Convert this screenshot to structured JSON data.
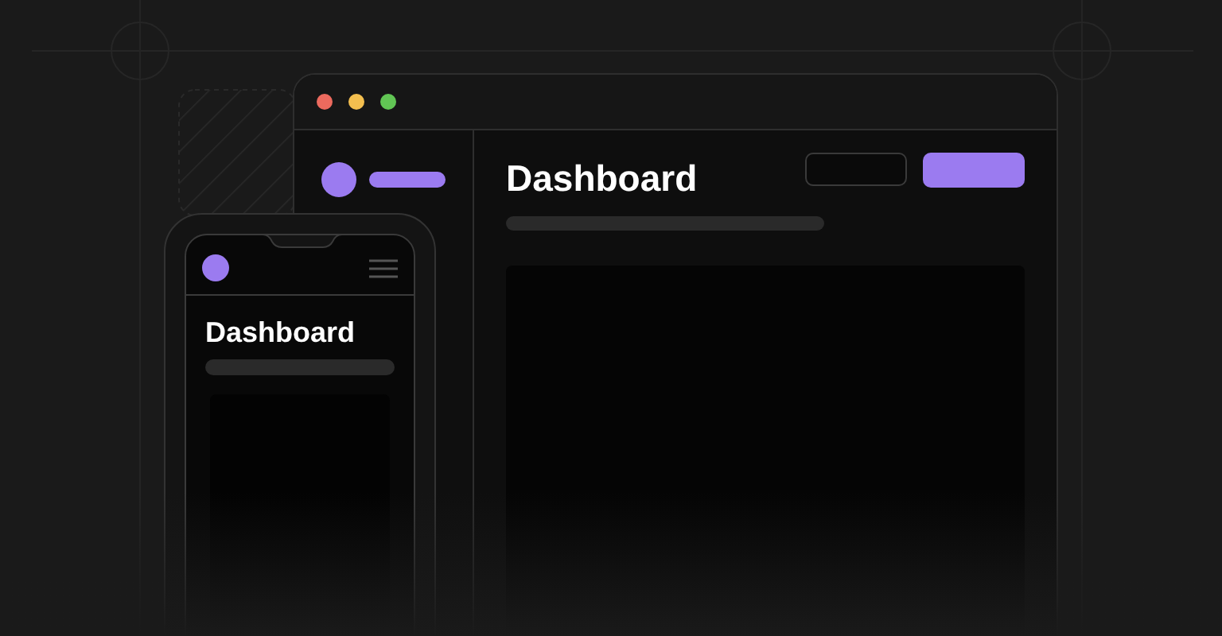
{
  "desktop": {
    "heading": "Dashboard"
  },
  "mobile": {
    "heading": "Dashboard"
  }
}
